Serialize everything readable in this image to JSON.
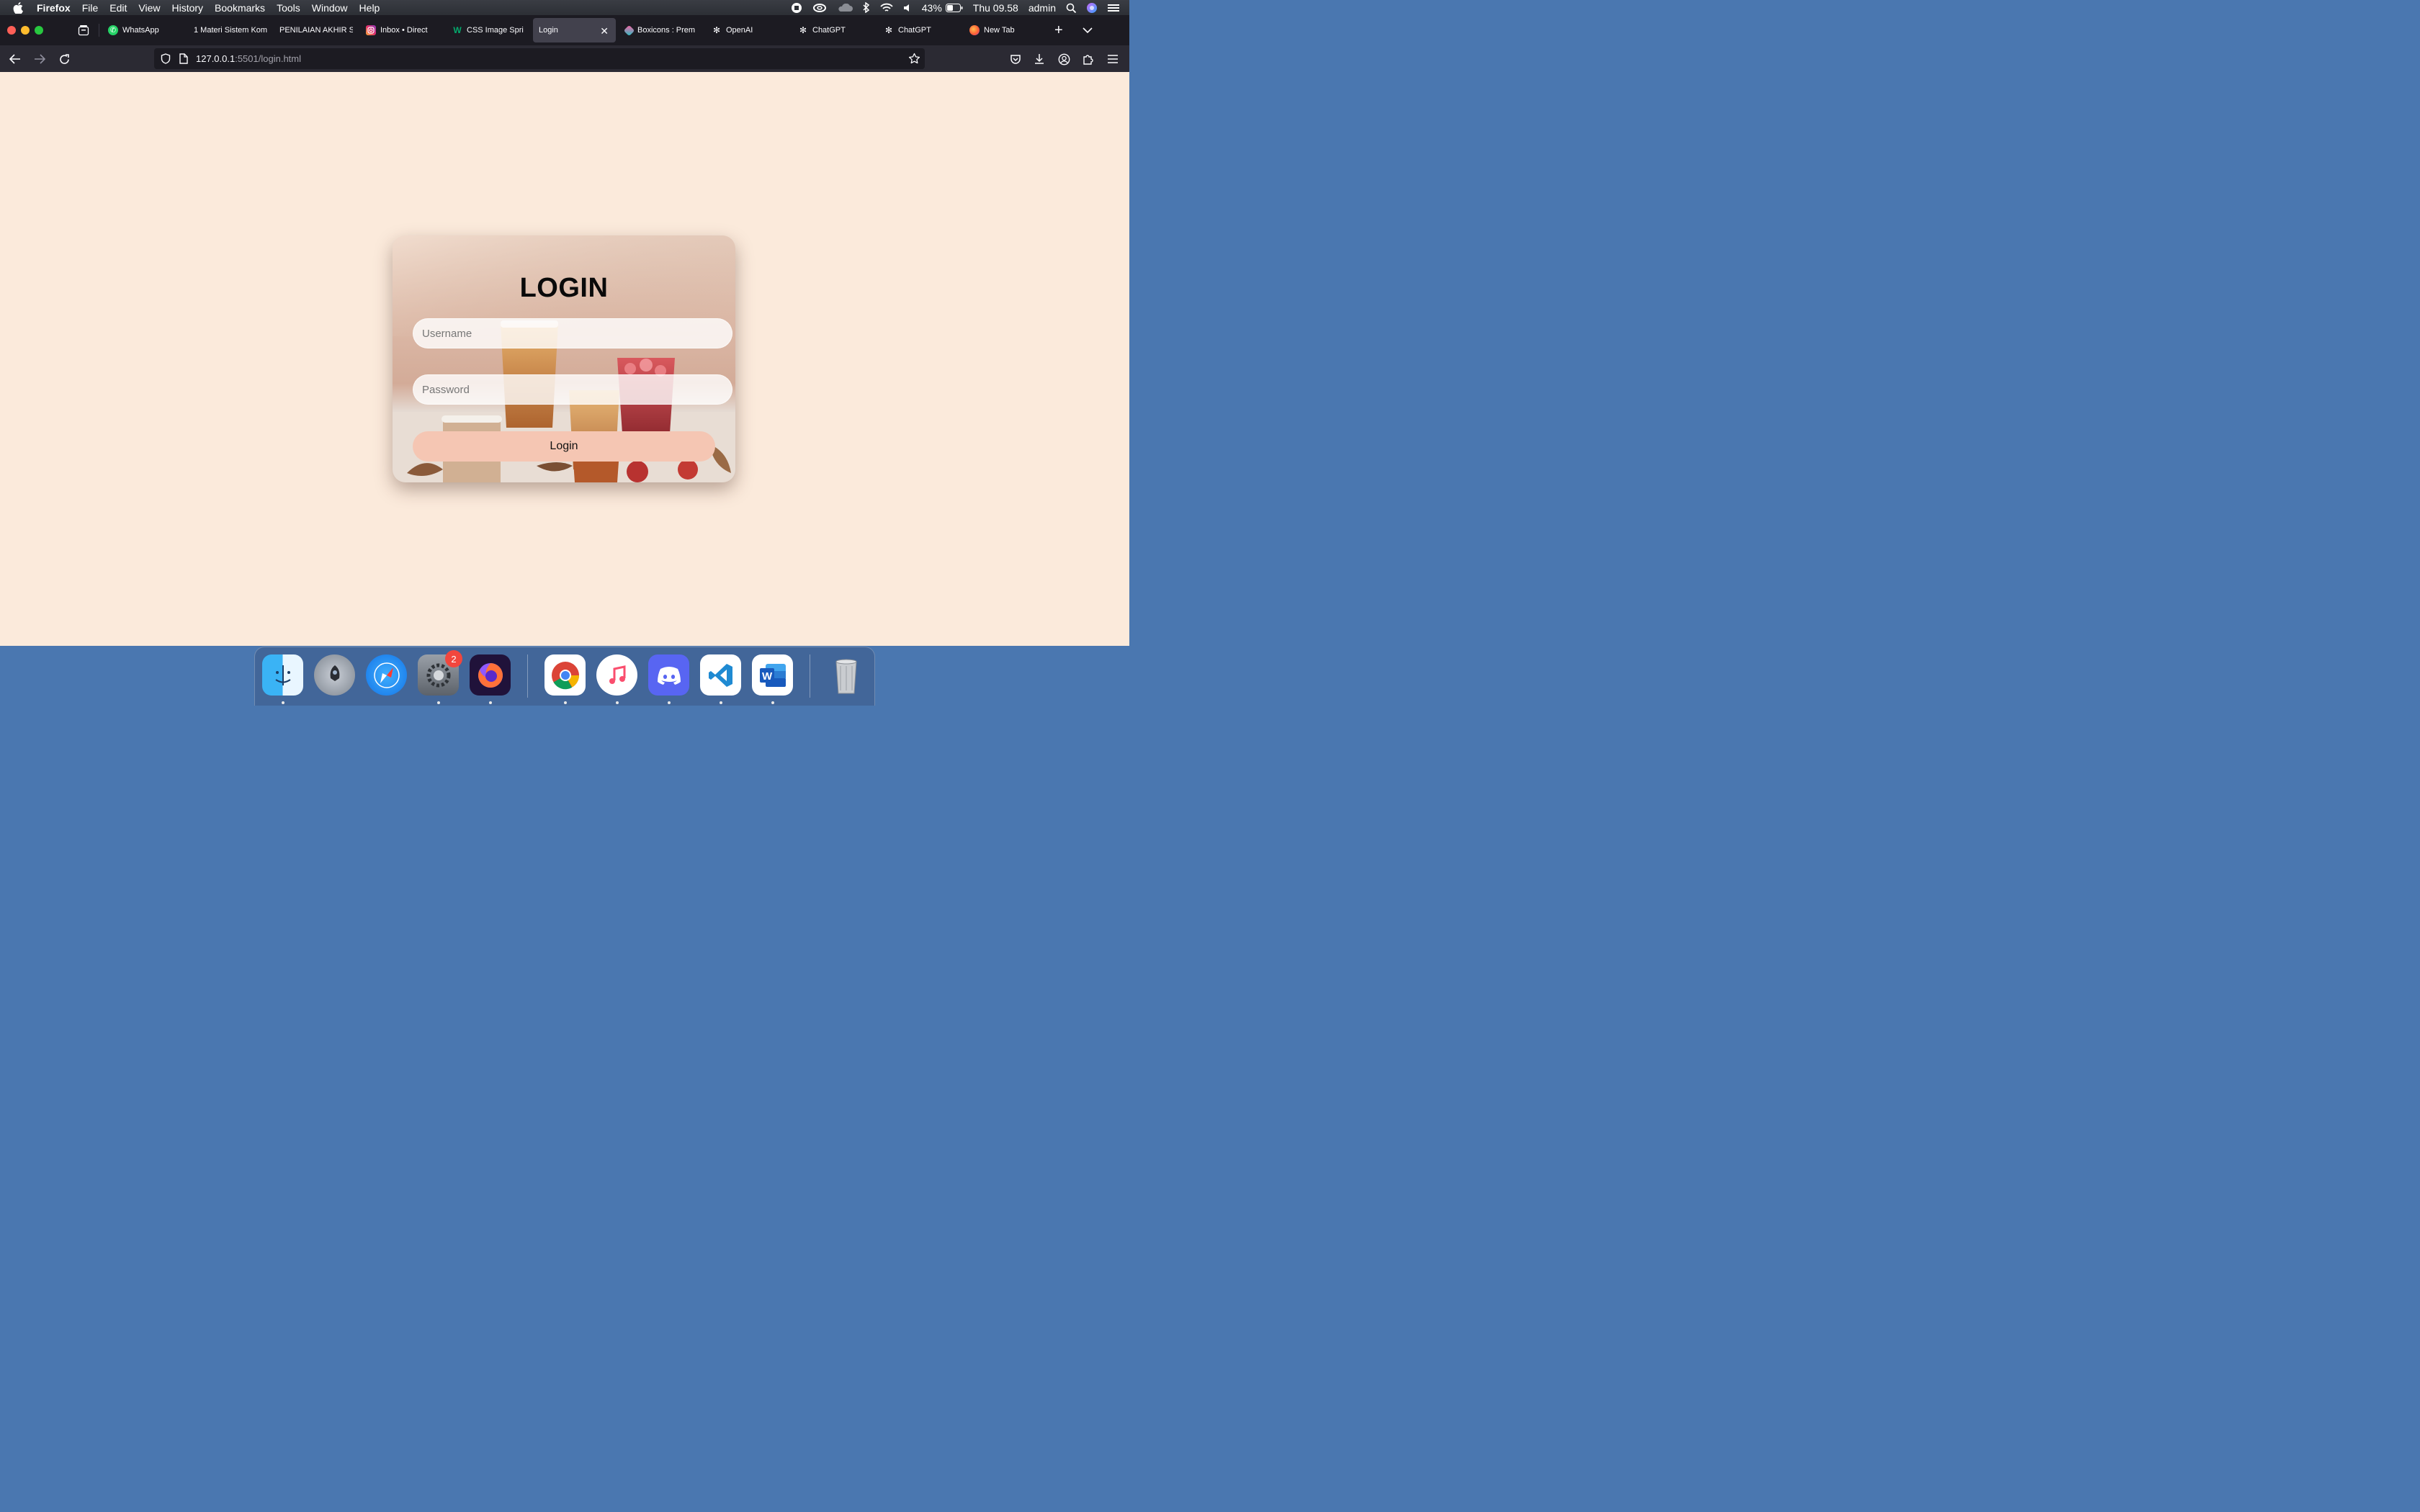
{
  "menubar": {
    "app_name": "Firefox",
    "items": [
      "File",
      "Edit",
      "View",
      "History",
      "Bookmarks",
      "Tools",
      "Window",
      "Help"
    ],
    "battery": "43%",
    "clock": "Thu 09.58",
    "user": "admin"
  },
  "tabs": [
    {
      "label": "WhatsApp",
      "icon": "whatsapp-icon"
    },
    {
      "label": "1 Materi Sistem Kom",
      "icon": ""
    },
    {
      "label": "PENILAIAN AKHIR S",
      "icon": ""
    },
    {
      "label": "Inbox • Direct",
      "icon": "instagram-icon"
    },
    {
      "label": "CSS Image Spri",
      "icon": "w3schools-icon"
    },
    {
      "label": "Login",
      "icon": "",
      "active": true
    },
    {
      "label": "Boxicons : Prem",
      "icon": "boxicons-icon"
    },
    {
      "label": "OpenAI",
      "icon": "openai-icon"
    },
    {
      "label": "ChatGPT",
      "icon": "openai-icon"
    },
    {
      "label": "ChatGPT",
      "icon": "openai-icon"
    },
    {
      "label": "New Tab",
      "icon": "firefox-icon"
    }
  ],
  "address": {
    "host": "127.0.0.1",
    "path": ":5501/login.html"
  },
  "login": {
    "title": "LOGIN",
    "username_placeholder": "Username",
    "password_placeholder": "Password",
    "button_label": "Login"
  },
  "dock": {
    "apps": [
      "Finder",
      "Launchpad",
      "Safari",
      "System Preferences",
      "Firefox",
      "Google Chrome",
      "Music",
      "Discord",
      "Visual Studio Code",
      "Microsoft Word",
      "Trash"
    ],
    "settings_badge": "2"
  },
  "colors": {
    "page_bg": "#fbeadb",
    "button_bg": "#f5c6b3",
    "tabbar_bg": "#1c1b22",
    "navbar_bg": "#2b2a33"
  }
}
